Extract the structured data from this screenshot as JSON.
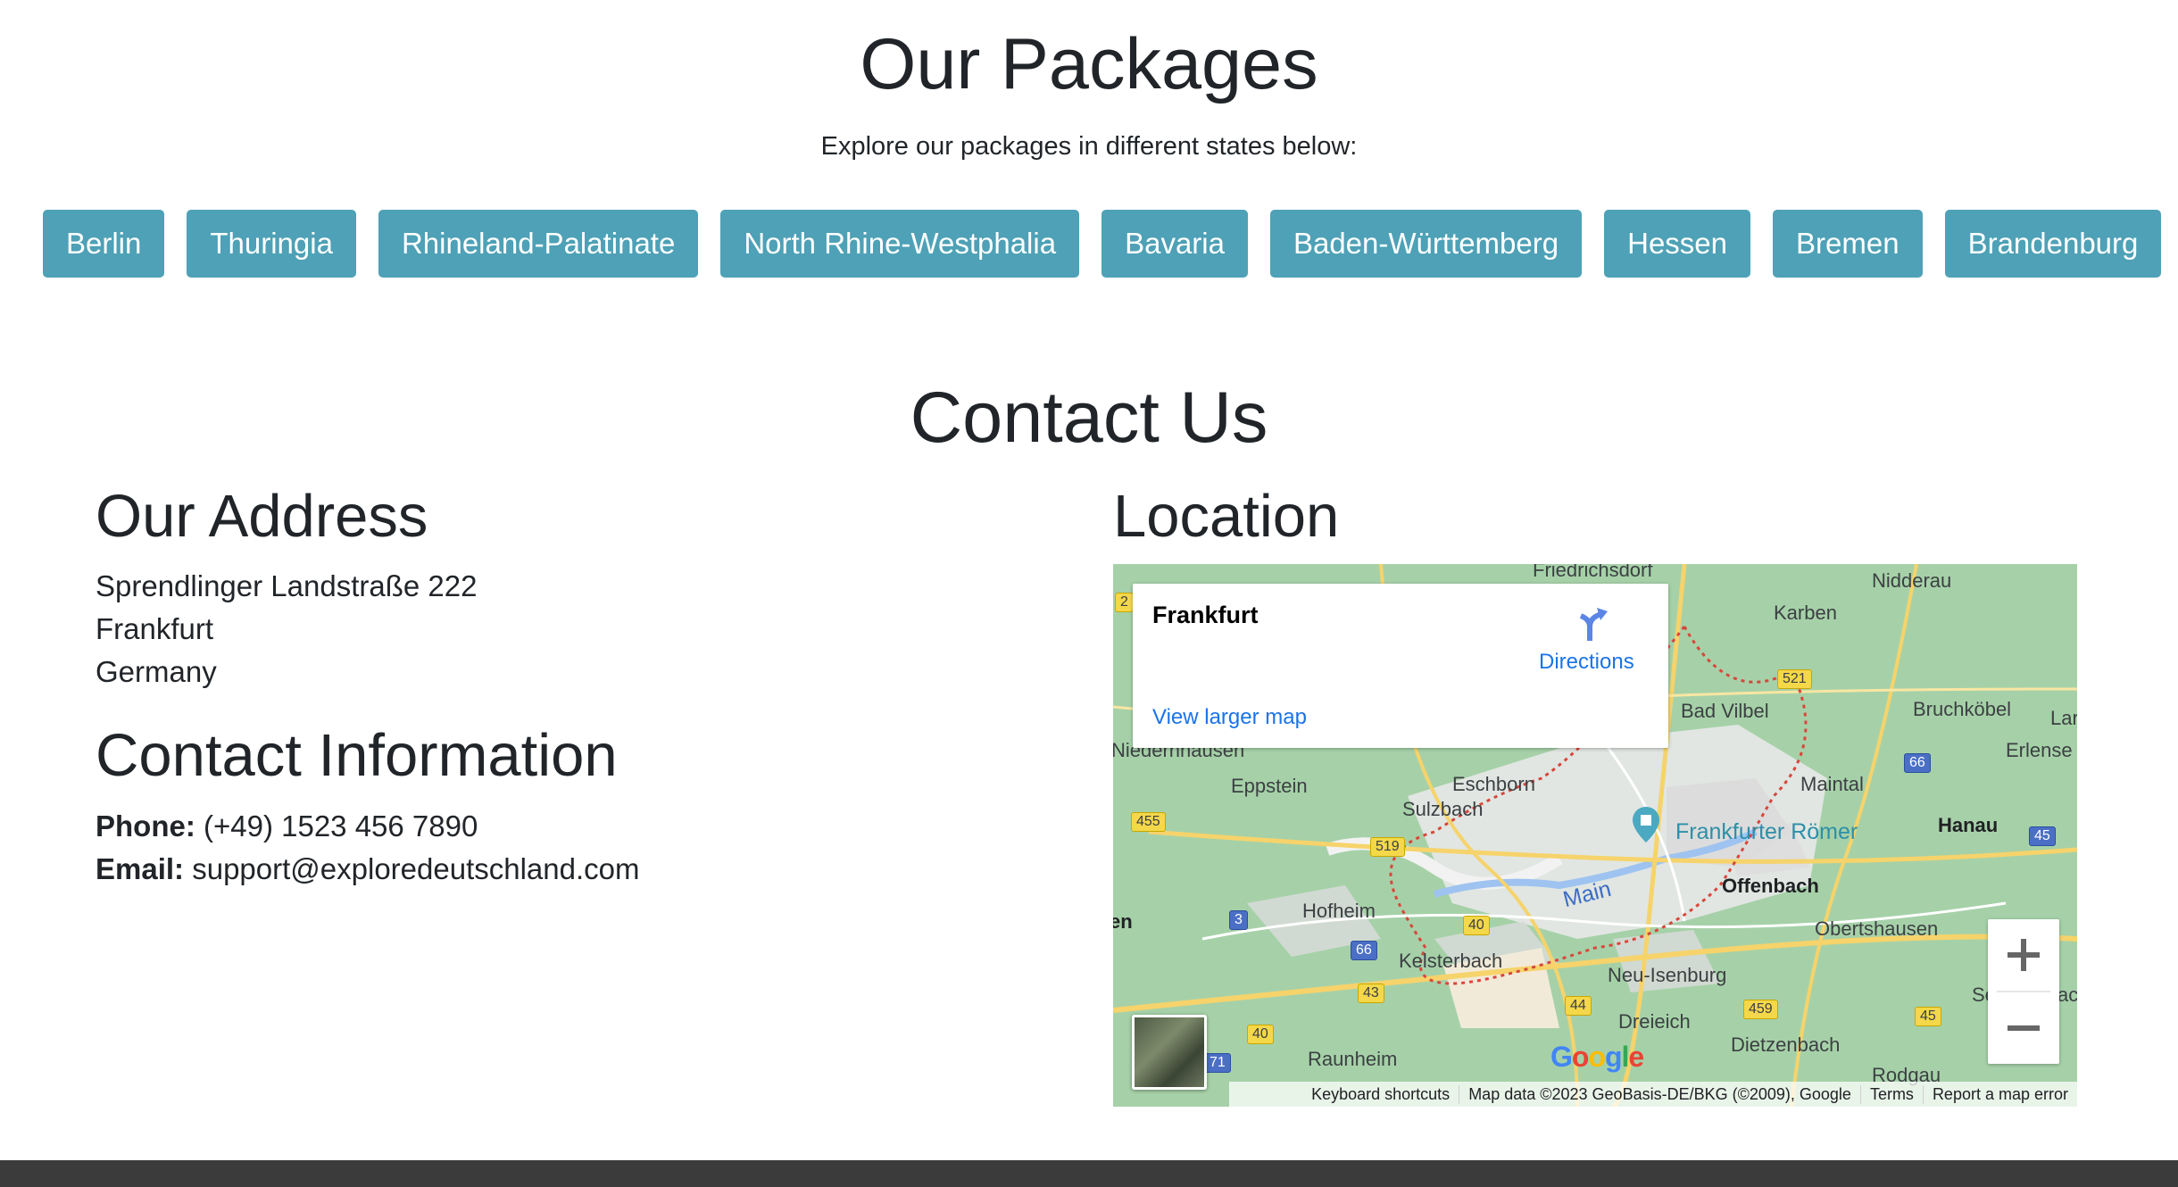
{
  "packages": {
    "title": "Our Packages",
    "subtitle": "Explore our packages in different states below:",
    "buttons": [
      "Berlin",
      "Thuringia",
      "Rhineland-Palatinate",
      "North Rhine-Westphalia",
      "Bavaria",
      "Baden-Württemberg",
      "Hessen",
      "Bremen",
      "Brandenburg"
    ],
    "button_color": "#4ea1b6"
  },
  "contact": {
    "title": "Contact Us",
    "address": {
      "heading": "Our Address",
      "lines": [
        "Sprendlinger Landstraße 222",
        "Frankfurt",
        "Germany"
      ]
    },
    "info": {
      "heading": "Contact Information",
      "phone_label": "Phone:",
      "phone": "(+49) 1523 456 7890",
      "email_label": "Email:",
      "email": "support@exploredeutschland.com"
    },
    "location": {
      "heading": "Location",
      "map": {
        "card_title": "Frankfurt",
        "directions_label": "Directions",
        "larger_map_label": "View larger map",
        "zoom_in": "+",
        "zoom_out": "−",
        "attribution": [
          "Keyboard shortcuts",
          "Map data ©2023 GeoBasis-DE/BKG (©2009), Google",
          "Terms",
          "Report a map error"
        ],
        "logo": [
          "G",
          "o",
          "o",
          "g",
          "l",
          "e"
        ],
        "places": [
          "Friedrichsdorf",
          "Nidderau",
          "Karben",
          "Bad Vilbel",
          "Bruchköbel",
          "Erlense",
          "Niedernhausen",
          "Eppstein",
          "Eschborn",
          "Sulzbach",
          "Maintal",
          "Hanau",
          "Frankfurter Römer",
          "Offenbach",
          "Hofheim",
          "Main",
          "Obertshausen",
          "Kelsterbach",
          "Neu-Isenburg",
          "Dreieich",
          "Dietzenbach",
          "Raunheim",
          "Rodgau",
          "en",
          "Lar",
          "Se",
          "ac"
        ],
        "road_numbers": [
          "2",
          "521",
          "66",
          "455",
          "519",
          "45",
          "3",
          "40",
          "66",
          "43",
          "44",
          "459",
          "45",
          "40",
          "71"
        ]
      }
    }
  },
  "footer_color": "#3b3b3b"
}
